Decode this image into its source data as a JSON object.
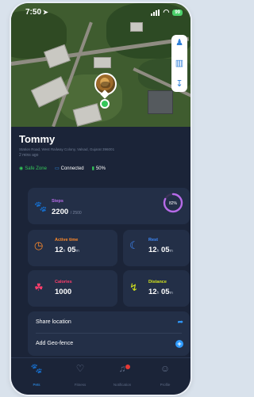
{
  "status_bar": {
    "time": "7:50",
    "location_arrow": "location-arrow-icon",
    "battery": "99"
  },
  "pet": {
    "name": "Tommy",
    "address": "Station Road, West Railway Colony, Valsad, Gujarat 396001",
    "updated": "2 mins ago"
  },
  "status": {
    "safe_zone": "Safe Zone",
    "connection": "Connected",
    "battery": "50%"
  },
  "steps": {
    "title": "Steps",
    "value": "2200",
    "goal": "/ 2500",
    "progress_label": "82%",
    "progress_fraction": 0.82
  },
  "active_time": {
    "title": "Active time",
    "hours": "12",
    "h_unit": "h",
    "minutes": "05",
    "m_unit": "m"
  },
  "rest": {
    "title": "Rest",
    "hours": "12",
    "h_unit": "h",
    "minutes": "05",
    "m_unit": "m"
  },
  "calories": {
    "title": "Calories",
    "value": "1000"
  },
  "distance": {
    "title": "Distance",
    "hours": "12",
    "h_unit": "h",
    "minutes": "05",
    "m_unit": "m"
  },
  "actions": {
    "share_location": "Share location",
    "add_geofence": "Add Geo-fence"
  },
  "tabs": [
    {
      "label": "Pets",
      "icon": "paw-icon",
      "active": true
    },
    {
      "label": "Fitness",
      "icon": "heart-pulse-icon",
      "active": false
    },
    {
      "label": "Notification",
      "icon": "bell-icon",
      "active": false
    },
    {
      "label": "Profile",
      "icon": "user-icon",
      "active": false
    }
  ],
  "colors": {
    "background": "#1b2438",
    "card": "#232f47",
    "accent_blue": "#2f9bff",
    "steps": "#b66be8",
    "active_time": "#ff8a2a",
    "rest": "#3f8cff",
    "calories": "#ff3e6c",
    "distance": "#d4e41c",
    "safe": "#34c759"
  }
}
